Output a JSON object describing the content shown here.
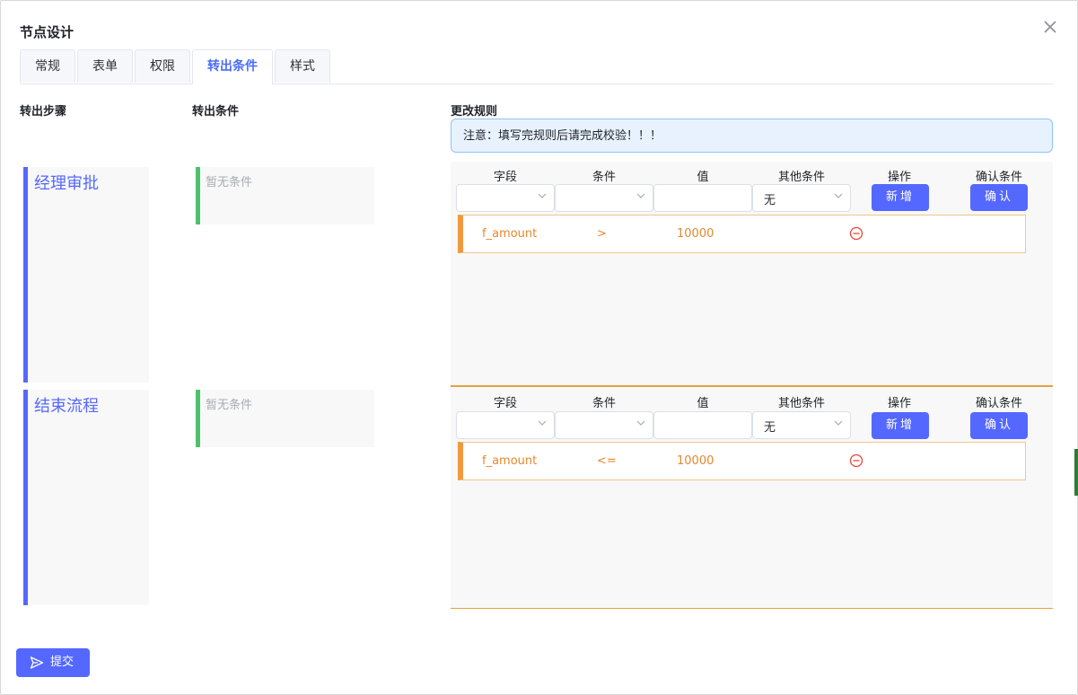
{
  "dialog": {
    "title": "节点设计"
  },
  "tabs": [
    {
      "label": "常规",
      "active": false
    },
    {
      "label": "表单",
      "active": false
    },
    {
      "label": "权限",
      "active": false
    },
    {
      "label": "转出条件",
      "active": true
    },
    {
      "label": "样式",
      "active": false
    }
  ],
  "columns": {
    "steps_heading": "转出步骤",
    "conditions_heading": "转出条件",
    "rules_heading": "更改规则"
  },
  "notice": "注意：填写完规则后请完成校验！！！",
  "rule_headers": {
    "field": "字段",
    "condition": "条件",
    "value": "值",
    "other": "其他条件",
    "action": "操作",
    "confirm": "确认条件"
  },
  "buttons": {
    "add": "新增",
    "confirm": "确认",
    "submit": "提交"
  },
  "steps": [
    {
      "name": "经理审批",
      "conditions_text": "暂无条件",
      "form": {
        "field": "",
        "condition": "",
        "value": "",
        "other": "无"
      },
      "rule": {
        "field": "f_amount",
        "operator": ">",
        "value": "10000"
      }
    },
    {
      "name": "结束流程",
      "conditions_text": "暂无条件",
      "form": {
        "field": "",
        "condition": "",
        "value": "",
        "other": "无"
      },
      "rule": {
        "field": "f_amount",
        "operator": "<=",
        "value": "10000"
      }
    }
  ],
  "colors": {
    "accent": "#5468ff",
    "active_tab": "#4a6cf7",
    "condition_bar": "#4cc26b",
    "rule_text": "#e6882e",
    "remove_icon": "#e5483a",
    "notice_bg": "#e8f2fe"
  },
  "icons": {
    "close": "close-icon",
    "chevron": "chevron-down-icon",
    "remove": "minus-circle-icon",
    "send": "send-icon"
  }
}
